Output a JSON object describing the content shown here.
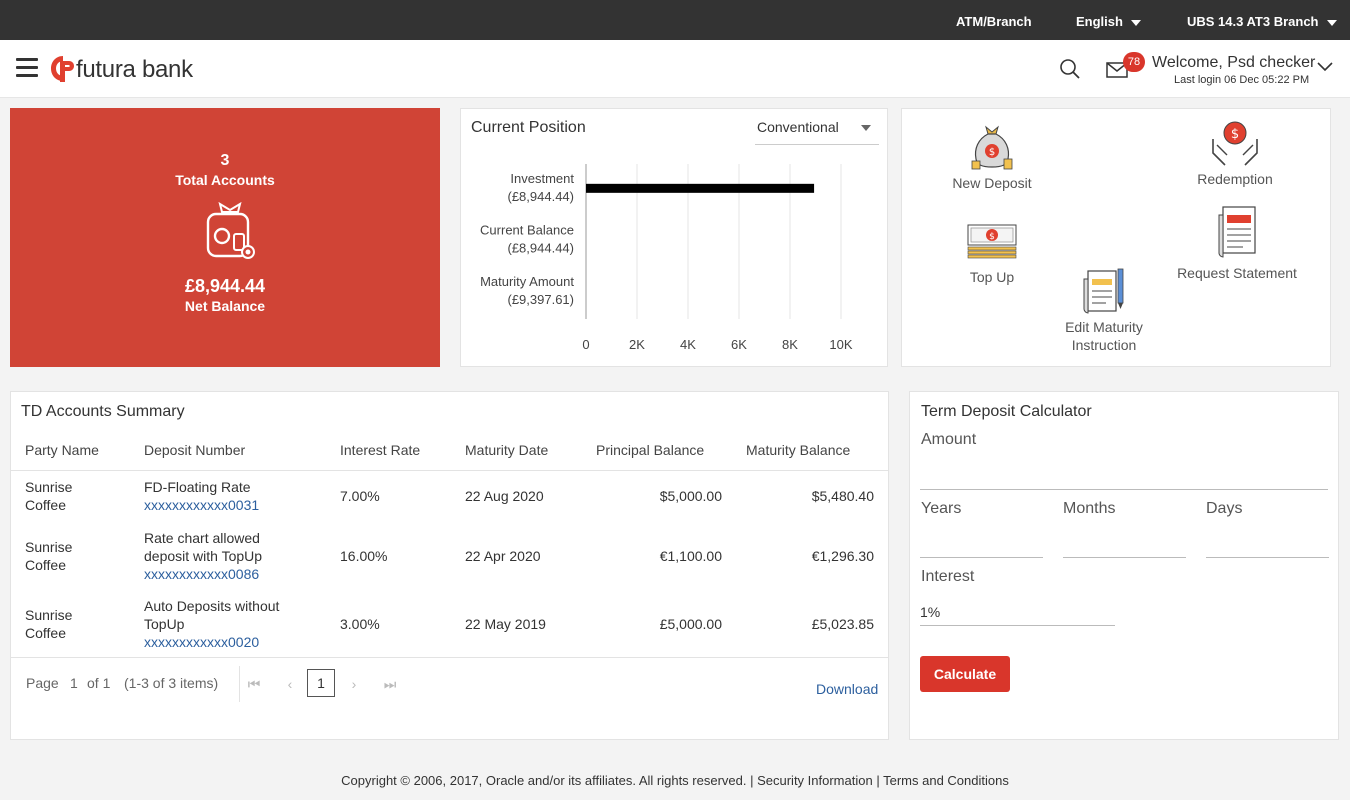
{
  "topbar": {
    "atm_branch": "ATM/Branch",
    "language": "English",
    "branch": "UBS 14.3 AT3 Branch"
  },
  "header": {
    "bank_name": "futura bank",
    "notifications_count": "78",
    "welcome": "Welcome, Psd checker",
    "last_login": "Last login 06 Dec 05:22 PM"
  },
  "summary": {
    "total_accounts_count": "3",
    "total_accounts_label": "Total Accounts",
    "net_balance": "£8,944.44",
    "net_balance_label": "Net Balance"
  },
  "current_position": {
    "title": "Current Position",
    "selected_option": "Conventional"
  },
  "chart_data": {
    "type": "bar",
    "orientation": "horizontal",
    "title": "Current Position",
    "categories": [
      "Investment",
      "Current Balance",
      "Maturity Amount"
    ],
    "category_sublabels": [
      "(£8,944.44)",
      "(£8,944.44)",
      "(£9,397.61)"
    ],
    "values": [
      8944.44,
      0,
      0
    ],
    "xlim": [
      0,
      10000
    ],
    "x_ticks": [
      0,
      2000,
      4000,
      6000,
      8000,
      10000
    ],
    "x_tick_labels": [
      "0",
      "2K",
      "4K",
      "6K",
      "8K",
      "10K"
    ],
    "grid": true,
    "bar_color": "#000000"
  },
  "quick_links": {
    "new_deposit": "New Deposit",
    "redemption": "Redemption",
    "top_up": "Top Up",
    "request_statement": "Request Statement",
    "edit_maturity_line1": "Edit Maturity",
    "edit_maturity_line2": "Instruction"
  },
  "td_summary": {
    "title": "TD Accounts Summary",
    "columns": [
      "Party Name",
      "Deposit Number",
      "Interest Rate",
      "Maturity Date",
      "Principal Balance",
      "Maturity Balance"
    ],
    "rows": [
      {
        "party_line1": "Sunrise",
        "party_line2": "Coffee",
        "deposit_line1": "FD-Floating Rate",
        "deposit_line2": "",
        "account": "xxxxxxxxxxxx0031",
        "rate": "7.00%",
        "maturity_date": "22 Aug 2020",
        "principal": "$5,000.00",
        "maturity_balance": "$5,480.40"
      },
      {
        "party_line1": "Sunrise",
        "party_line2": "Coffee",
        "deposit_line1": "Rate chart allowed",
        "deposit_line2": "deposit with TopUp",
        "account": "xxxxxxxxxxxx0086",
        "rate": "16.00%",
        "maturity_date": "22 Apr 2020",
        "principal": "€1,100.00",
        "maturity_balance": "€1,296.30"
      },
      {
        "party_line1": "Sunrise",
        "party_line2": "Coffee",
        "deposit_line1": "Auto Deposits without",
        "deposit_line2": "TopUp",
        "account": "xxxxxxxxxxxx0020",
        "rate": "3.00%",
        "maturity_date": "22 May 2019",
        "principal": "£5,000.00",
        "maturity_balance": "£5,023.85"
      }
    ],
    "pager": {
      "page_label": "Page",
      "current_page": "1",
      "of_pages": "of 1",
      "items_info": "(1-3 of 3 items)",
      "page_button": "1",
      "download": "Download"
    }
  },
  "calculator": {
    "title": "Term Deposit Calculator",
    "amount_label": "Amount",
    "amount_value": "",
    "years_label": "Years",
    "months_label": "Months",
    "days_label": "Days",
    "interest_label": "Interest",
    "interest_value": "1%",
    "calculate_button": "Calculate"
  },
  "footer": {
    "copyright": "Copyright © 2006, 2017, Oracle and/or its affiliates. All rights reserved. |",
    "security": "Security Information",
    "sep": "|",
    "terms": "Terms and Conditions"
  },
  "colors": {
    "topbar": "#333333",
    "accent_red": "#d04436",
    "badge_red": "#d9362b",
    "link_blue": "#2c5f9e"
  }
}
